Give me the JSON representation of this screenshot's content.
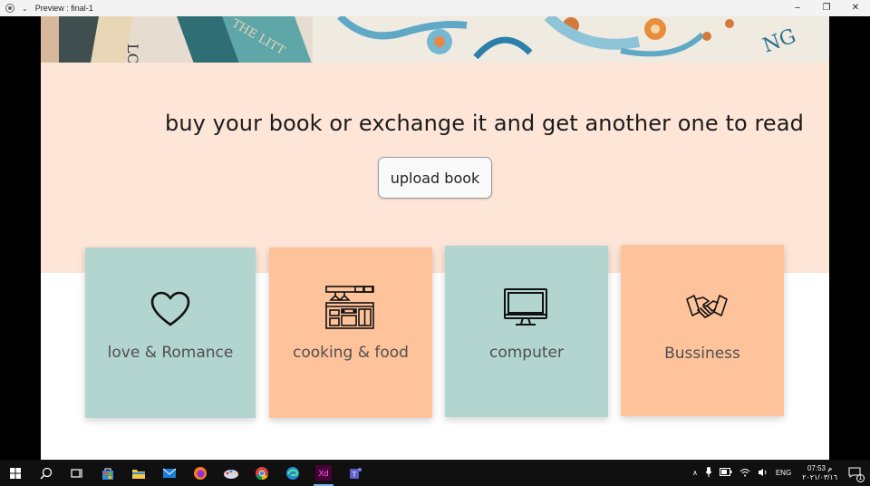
{
  "window": {
    "title": "Preview : final-1",
    "controls": [
      "–",
      "❐",
      "✕"
    ]
  },
  "hero": {
    "book_text_1": "LO",
    "book_text_2": "THE LITT",
    "book_text_3": "NG"
  },
  "main": {
    "headline": "buy your book or exchange it and get another one to read",
    "upload_label": "upload book"
  },
  "categories": [
    {
      "label": "love & Romance",
      "icon": "heart-icon",
      "color": "#b2d5cf"
    },
    {
      "label": "cooking & food",
      "icon": "kitchen-icon",
      "color": "#fec39b"
    },
    {
      "label": "computer",
      "icon": "monitor-icon",
      "color": "#b2d5cf"
    },
    {
      "label": "Bussiness",
      "icon": "handshake-icon",
      "color": "#fec39b"
    }
  ],
  "taskbar": {
    "apps": [
      "windows-start-icon",
      "search-icon",
      "task-view-icon",
      "store-icon",
      "file-explorer-icon",
      "mail-icon",
      "firefox-icon",
      "paint-icon",
      "chrome-icon",
      "edge-icon",
      "adobe-xd-icon",
      "teams-icon"
    ],
    "xd_label": "Xd",
    "language": "ENG",
    "time": "07:53 م",
    "date": "٢٠٢١/٠٣/١٦",
    "notification_count": "1"
  }
}
